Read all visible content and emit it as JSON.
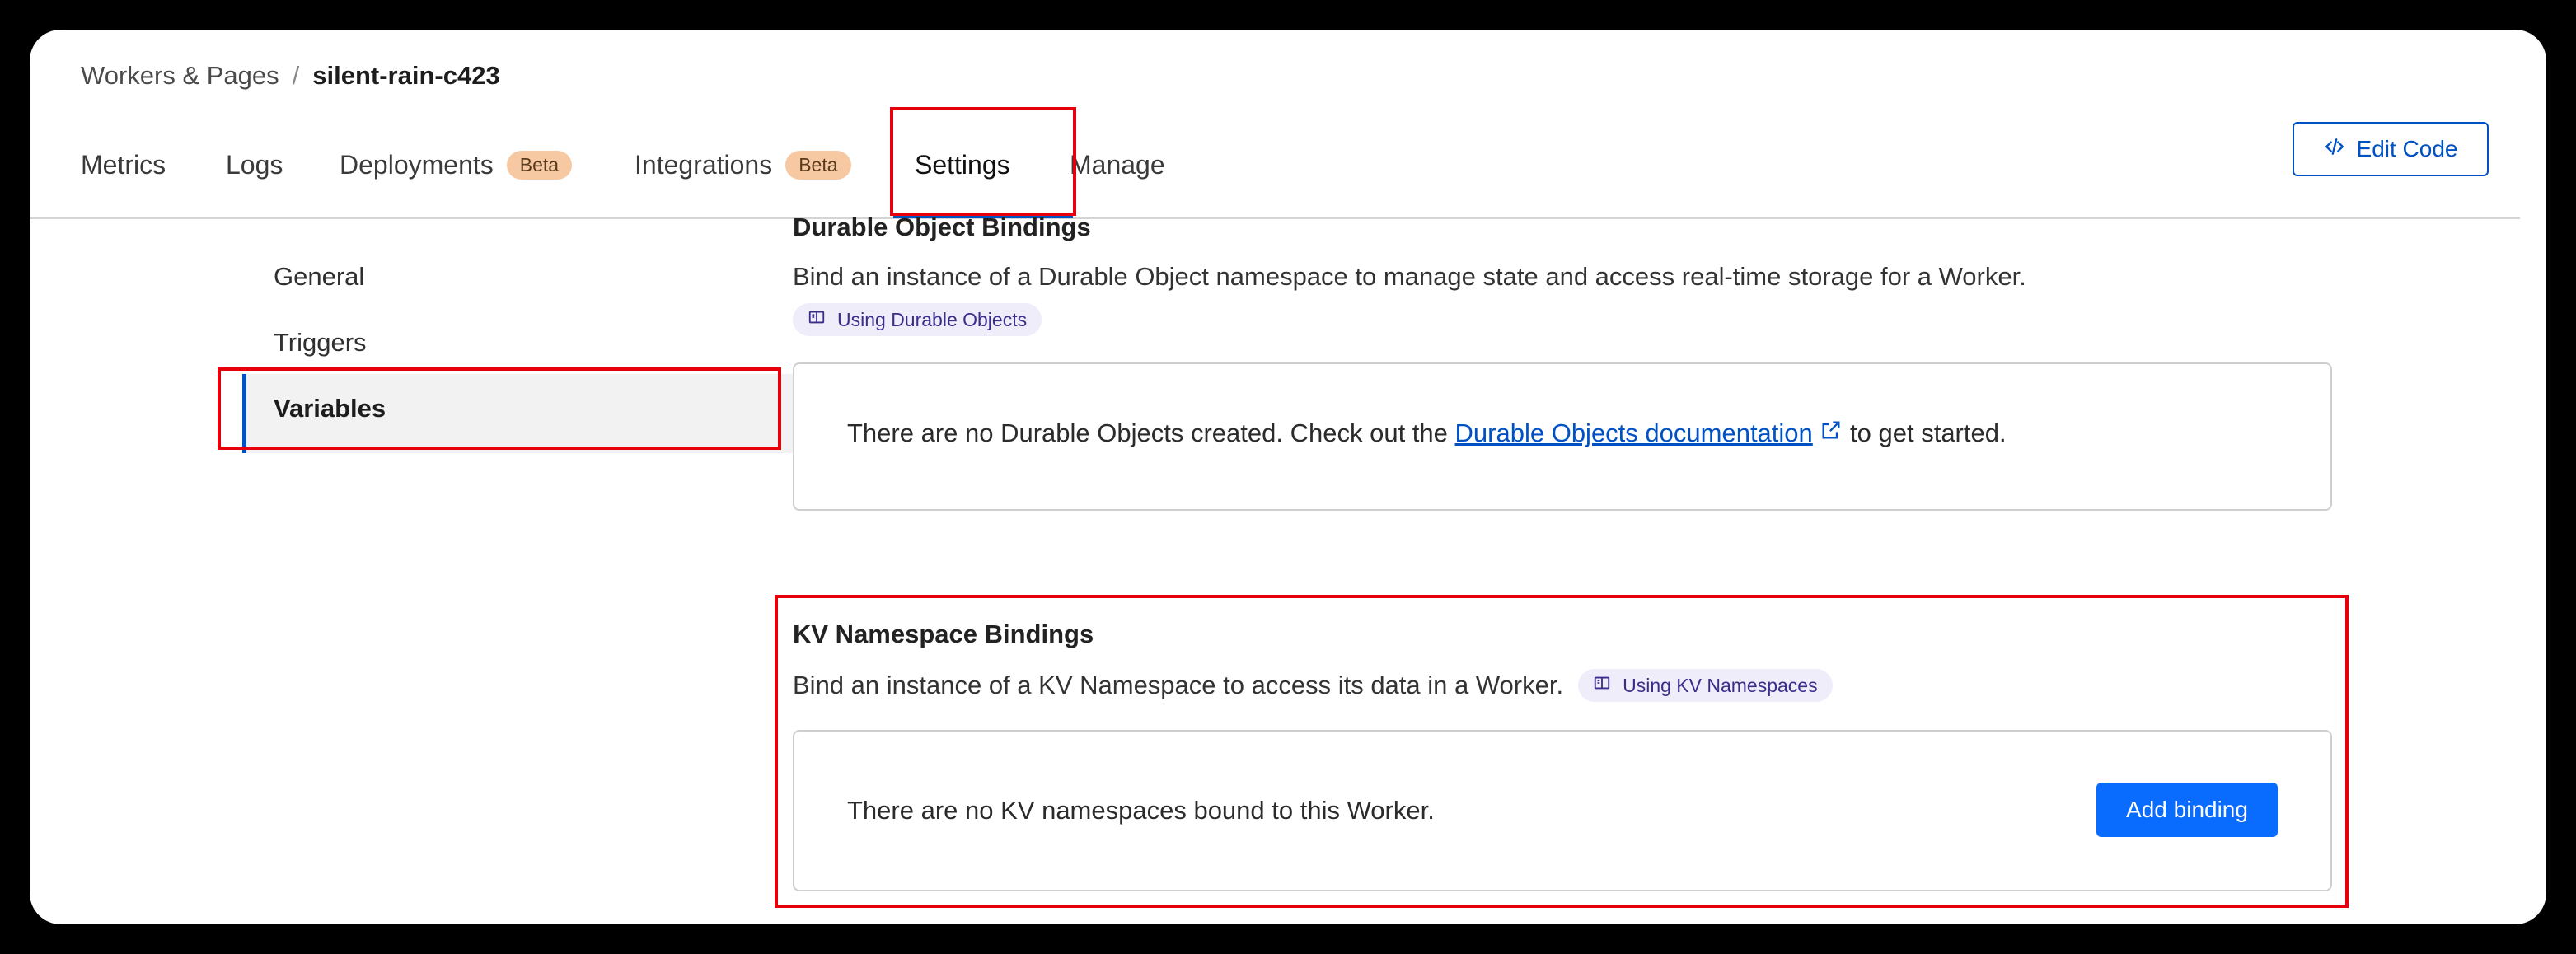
{
  "breadcrumb": {
    "parent": "Workers & Pages",
    "separator": "/",
    "current": "silent-rain-c423"
  },
  "tabs": [
    {
      "label": "Metrics"
    },
    {
      "label": "Logs"
    },
    {
      "label": "Deployments",
      "badge": "Beta"
    },
    {
      "label": "Integrations",
      "badge": "Beta"
    },
    {
      "label": "Settings",
      "active": true
    },
    {
      "label": "Manage"
    }
  ],
  "header": {
    "edit_code_label": "Edit Code"
  },
  "sidebar": {
    "items": [
      {
        "label": "General"
      },
      {
        "label": "Triggers"
      },
      {
        "label": "Variables",
        "active": true
      }
    ]
  },
  "durable": {
    "title": "Durable Object Bindings",
    "description": "Bind an instance of a Durable Object namespace to manage state and access real-time storage for a Worker.",
    "chip_label": "Using Durable Objects",
    "empty_prefix": "There are no Durable Objects created. Check out the",
    "link_text": "Durable Objects documentation",
    "empty_suffix": "to get started."
  },
  "kv": {
    "title": "KV Namespace Bindings",
    "description": "Bind an instance of a KV Namespace to access its data in a Worker.",
    "chip_label": "Using KV Namespaces",
    "empty_text": "There are no KV namespaces bound to this Worker.",
    "add_label": "Add binding"
  },
  "colors": {
    "accent": "#0051c3",
    "button": "#0a6cff",
    "highlight": "#e6000b",
    "badge": "#f6c9a2",
    "chip": "#eeedf9"
  }
}
